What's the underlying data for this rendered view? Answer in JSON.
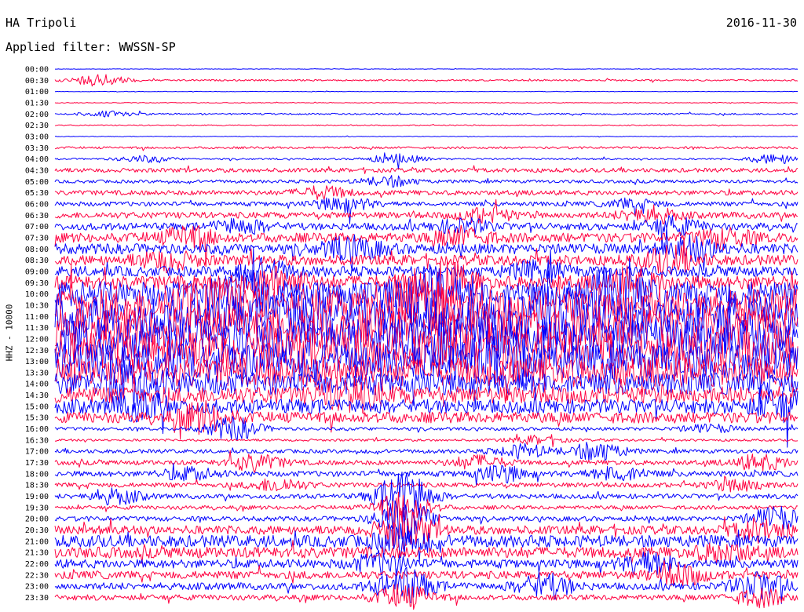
{
  "header": {
    "station": "HA Tripoli",
    "date": "2016-11-30",
    "filter": "Applied filter: WWSSN-SP"
  },
  "axis": {
    "ylabel": "HHZ - 10000"
  },
  "chart_data": {
    "type": "line",
    "title": "HA Tripoli",
    "subtitle": "Applied filter: WWSSN-SP",
    "ylabel": "HHZ - 10000",
    "trace_colors": [
      "#0000ff",
      "#ff0040"
    ],
    "rows": [
      {
        "t": "00:00",
        "a": 0.3,
        "events": []
      },
      {
        "t": "00:30",
        "a": 1.0,
        "events": [
          {
            "x": 0.06,
            "a": 7
          }
        ]
      },
      {
        "t": "01:00",
        "a": 0.3,
        "events": []
      },
      {
        "t": "01:30",
        "a": 0.4,
        "events": []
      },
      {
        "t": "02:00",
        "a": 1.0,
        "events": [
          {
            "x": 0.07,
            "a": 3
          }
        ]
      },
      {
        "t": "02:30",
        "a": 0.6,
        "events": []
      },
      {
        "t": "03:00",
        "a": 0.4,
        "events": []
      },
      {
        "t": "03:30",
        "a": 1.4,
        "events": []
      },
      {
        "t": "04:00",
        "a": 1.0,
        "events": [
          {
            "x": 0.12,
            "a": 4
          },
          {
            "x": 0.46,
            "a": 6
          },
          {
            "x": 0.97,
            "a": 6
          }
        ]
      },
      {
        "t": "04:30",
        "a": 2.6,
        "events": []
      },
      {
        "t": "05:00",
        "a": 2.0,
        "events": [
          {
            "x": 0.45,
            "a": 6
          }
        ]
      },
      {
        "t": "05:30",
        "a": 3.0,
        "events": [
          {
            "x": 0.36,
            "a": 7
          }
        ]
      },
      {
        "t": "06:00",
        "a": 2.8,
        "events": [
          {
            "x": 0.39,
            "a": 9
          },
          {
            "x": 0.78,
            "a": 6
          }
        ]
      },
      {
        "t": "06:30",
        "a": 4.0,
        "events": [
          {
            "x": 0.58,
            "a": 8
          },
          {
            "x": 0.8,
            "a": 10
          }
        ]
      },
      {
        "t": "07:00",
        "a": 4.5,
        "events": [
          {
            "x": 0.25,
            "a": 8
          },
          {
            "x": 0.55,
            "a": 8
          },
          {
            "x": 0.83,
            "a": 10
          }
        ]
      },
      {
        "t": "07:30",
        "a": 6.0,
        "events": [
          {
            "x": 0.18,
            "a": 12
          },
          {
            "x": 0.55,
            "a": 10
          },
          {
            "x": 0.9,
            "a": 10
          }
        ]
      },
      {
        "t": "08:00",
        "a": 6.5,
        "events": [
          {
            "x": 0.4,
            "a": 13
          },
          {
            "x": 0.86,
            "a": 12
          }
        ]
      },
      {
        "t": "08:30",
        "a": 6.5,
        "events": [
          {
            "x": 0.15,
            "a": 10
          },
          {
            "x": 0.83,
            "a": 14
          }
        ]
      },
      {
        "t": "09:00",
        "a": 6.5,
        "events": [
          {
            "x": 0.28,
            "a": 12
          },
          {
            "x": 0.65,
            "a": 10
          }
        ]
      },
      {
        "t": "09:30",
        "a": 9.0,
        "events": [
          {
            "x": 0.3,
            "a": 15
          },
          {
            "x": 0.52,
            "a": 30
          },
          {
            "x": 0.78,
            "a": 14
          }
        ]
      },
      {
        "t": "10:00",
        "a": 16.0,
        "events": [
          {
            "x": 0.25,
            "a": 25
          },
          {
            "x": 0.5,
            "a": 30
          },
          {
            "x": 0.75,
            "a": 25
          }
        ]
      },
      {
        "t": "10:30",
        "a": 21.0,
        "events": [
          {
            "x": 0.2,
            "a": 30
          },
          {
            "x": 0.48,
            "a": 35
          }
        ]
      },
      {
        "t": "11:00",
        "a": 25.0,
        "events": [
          {
            "x": 0.35,
            "a": 30
          },
          {
            "x": 0.68,
            "a": 35
          }
        ]
      },
      {
        "t": "11:30",
        "a": 25.0,
        "events": []
      },
      {
        "t": "12:00",
        "a": 25.0,
        "events": [
          {
            "x": 0.55,
            "a": 30
          }
        ]
      },
      {
        "t": "12:30",
        "a": 24.0,
        "events": []
      },
      {
        "t": "13:00",
        "a": 22.0,
        "events": [
          {
            "x": 0.6,
            "a": 28
          }
        ]
      },
      {
        "t": "13:30",
        "a": 18.0,
        "events": []
      },
      {
        "t": "14:00",
        "a": 14.0,
        "events": [
          {
            "x": 0.1,
            "a": 20
          }
        ]
      },
      {
        "t": "14:30",
        "a": 11.0,
        "events": [
          {
            "x": 0.4,
            "a": 18
          }
        ]
      },
      {
        "t": "15:00",
        "a": 9.0,
        "events": [
          {
            "x": 0.12,
            "a": 14
          },
          {
            "x": 0.98,
            "a": 16
          }
        ]
      },
      {
        "t": "15:30",
        "a": 7.0,
        "events": [
          {
            "x": 0.2,
            "a": 16
          }
        ]
      },
      {
        "t": "16:00",
        "a": 2.0,
        "events": [
          {
            "x": 0.24,
            "a": 14
          },
          {
            "x": 0.88,
            "a": 5
          }
        ]
      },
      {
        "t": "16:30",
        "a": 1.5,
        "events": [
          {
            "x": 0.65,
            "a": 5
          }
        ]
      },
      {
        "t": "17:00",
        "a": 2.5,
        "events": [
          {
            "x": 0.63,
            "a": 8
          },
          {
            "x": 0.73,
            "a": 11
          }
        ]
      },
      {
        "t": "17:30",
        "a": 3.0,
        "events": [
          {
            "x": 0.27,
            "a": 10
          },
          {
            "x": 0.57,
            "a": 8
          },
          {
            "x": 0.95,
            "a": 9
          }
        ]
      },
      {
        "t": "18:00",
        "a": 3.5,
        "events": [
          {
            "x": 0.18,
            "a": 7
          },
          {
            "x": 0.6,
            "a": 9
          },
          {
            "x": 0.76,
            "a": 9
          }
        ]
      },
      {
        "t": "18:30",
        "a": 3.0,
        "events": [
          {
            "x": 0.3,
            "a": 8
          },
          {
            "x": 0.92,
            "a": 8
          }
        ]
      },
      {
        "t": "19:00",
        "a": 3.0,
        "events": [
          {
            "x": 0.08,
            "a": 9
          },
          {
            "x": 0.47,
            "a": 30
          }
        ]
      },
      {
        "t": "19:30",
        "a": 2.5,
        "events": [
          {
            "x": 0.47,
            "a": 20
          }
        ]
      },
      {
        "t": "20:00",
        "a": 3.0,
        "events": [
          {
            "x": 0.47,
            "a": 25
          },
          {
            "x": 0.97,
            "a": 14
          }
        ]
      },
      {
        "t": "20:30",
        "a": 5.5,
        "events": [
          {
            "x": 0.47,
            "a": 22
          },
          {
            "x": 0.95,
            "a": 12
          }
        ]
      },
      {
        "t": "21:00",
        "a": 7.5,
        "events": [
          {
            "x": 0.47,
            "a": 16
          }
        ]
      },
      {
        "t": "21:30",
        "a": 7.0,
        "events": [
          {
            "x": 0.9,
            "a": 10
          }
        ]
      },
      {
        "t": "22:00",
        "a": 5.5,
        "events": [
          {
            "x": 0.44,
            "a": 12
          },
          {
            "x": 0.8,
            "a": 12
          }
        ]
      },
      {
        "t": "22:30",
        "a": 5.0,
        "events": [
          {
            "x": 0.84,
            "a": 12
          }
        ]
      },
      {
        "t": "23:00",
        "a": 4.5,
        "events": [
          {
            "x": 0.47,
            "a": 20
          },
          {
            "x": 0.66,
            "a": 14
          },
          {
            "x": 0.95,
            "a": 16
          }
        ]
      },
      {
        "t": "23:30",
        "a": 3.5,
        "events": [
          {
            "x": 0.47,
            "a": 15
          },
          {
            "x": 0.95,
            "a": 10
          }
        ]
      }
    ]
  }
}
